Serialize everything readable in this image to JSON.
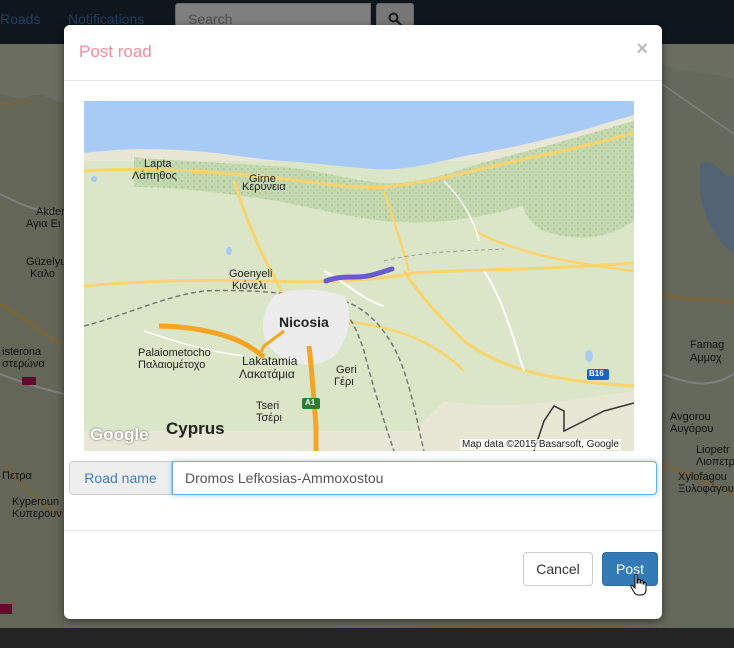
{
  "navbar": {
    "links": [
      {
        "label": "Roads"
      },
      {
        "label": "Notifications"
      }
    ],
    "search": {
      "placeholder": "Search",
      "button_icon": "search-icon"
    }
  },
  "background_map": {
    "labels": [
      "Akder",
      "Αγια Ει",
      "Güzelyu",
      "Καλο",
      "isterona",
      "στερώνα",
      "Πετρα",
      "Kyperoun",
      "Κυπερουν"
    ],
    "right_labels": [
      "Famag",
      "Αμμοχ",
      "Avgorou",
      "Αυγόρου",
      "Liopetr",
      "Λιοπετρ",
      "Xylofagou",
      "Ξυλοφάγου"
    ]
  },
  "modal": {
    "title": "Post road",
    "close_label": "×",
    "title_color": "#f38b9c",
    "map": {
      "labels": {
        "lapta": "Lapta",
        "lapta_gr": "Λάπηθος",
        "girne": "Girne",
        "girne_gr": "Κερύνεια",
        "goenyeli": "Goenyeli",
        "goenyeli_gr": "Κιόνελι",
        "nicosia": "Nicosia",
        "palaiometocho": "Palaiometocho",
        "palaiometocho_gr": "Παλαιομέτοχο",
        "lakatamia": "Lakatamia",
        "lakatamia_gr": "Λακατάμια",
        "geri": "Geri",
        "geri_gr": "Γέρι",
        "tseri": "Tseri",
        "tseri_gr": "Τσέρι",
        "cyprus": "Cyprus",
        "google": "Google",
        "attribution": "Map data ©2015 Basarsoft, Google",
        "a1": "A1",
        "b16": "B16"
      },
      "route_color": "#6a5acd"
    },
    "road_name": {
      "label": "Road name",
      "value": "Dromos Lefkosias-Ammoxostou"
    },
    "buttons": {
      "cancel": "Cancel",
      "post": "Post"
    }
  }
}
